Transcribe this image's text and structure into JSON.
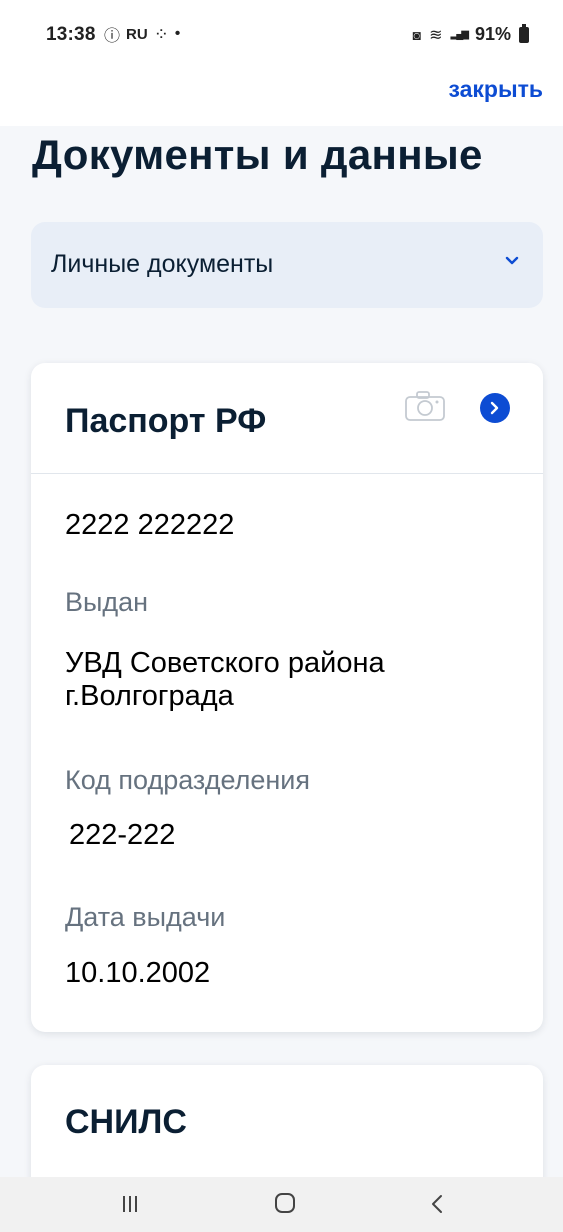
{
  "status_bar": {
    "time": "13:38",
    "left_icons": [
      "alert-circle-icon",
      "ru-icon",
      "dots-icon",
      "dot-icon"
    ],
    "left_glyphs": [
      "ⓘ",
      "RU",
      "⁘",
      "•"
    ],
    "battery": "91%",
    "right_icons": [
      "sim-icon",
      "wifi-icon",
      "signal-icon",
      "battery-icon"
    ],
    "right_glyphs": [
      "◙",
      "≋",
      "▂▄▆"
    ]
  },
  "header": {
    "close_label": "закрыть"
  },
  "page": {
    "title": "Документы и данные"
  },
  "dropdown": {
    "selected": "Личные документы",
    "icon": "chevron-down-icon"
  },
  "passport_card": {
    "title": "Паспорт РФ",
    "icons": [
      "camera-icon",
      "chevron-right-icon"
    ],
    "number": "2222 222222",
    "issued_label": "Выдан",
    "issued_value": "УВД Советского района г.Волгограда",
    "code_label": "Код подразделения",
    "code_value": "222-222",
    "date_label": "Дата выдачи",
    "date_value": "10.10.2002"
  },
  "snils_card": {
    "title": "СНИЛС"
  },
  "nav_bar": {
    "icons": [
      "recents-icon",
      "home-icon",
      "back-icon"
    ]
  },
  "colors": {
    "accent": "#0d4cd3",
    "text_primary": "#0b1f33",
    "text_secondary": "#66727f",
    "dropdown_bg": "#e8eef7",
    "page_bg": "#f5f7fa"
  }
}
